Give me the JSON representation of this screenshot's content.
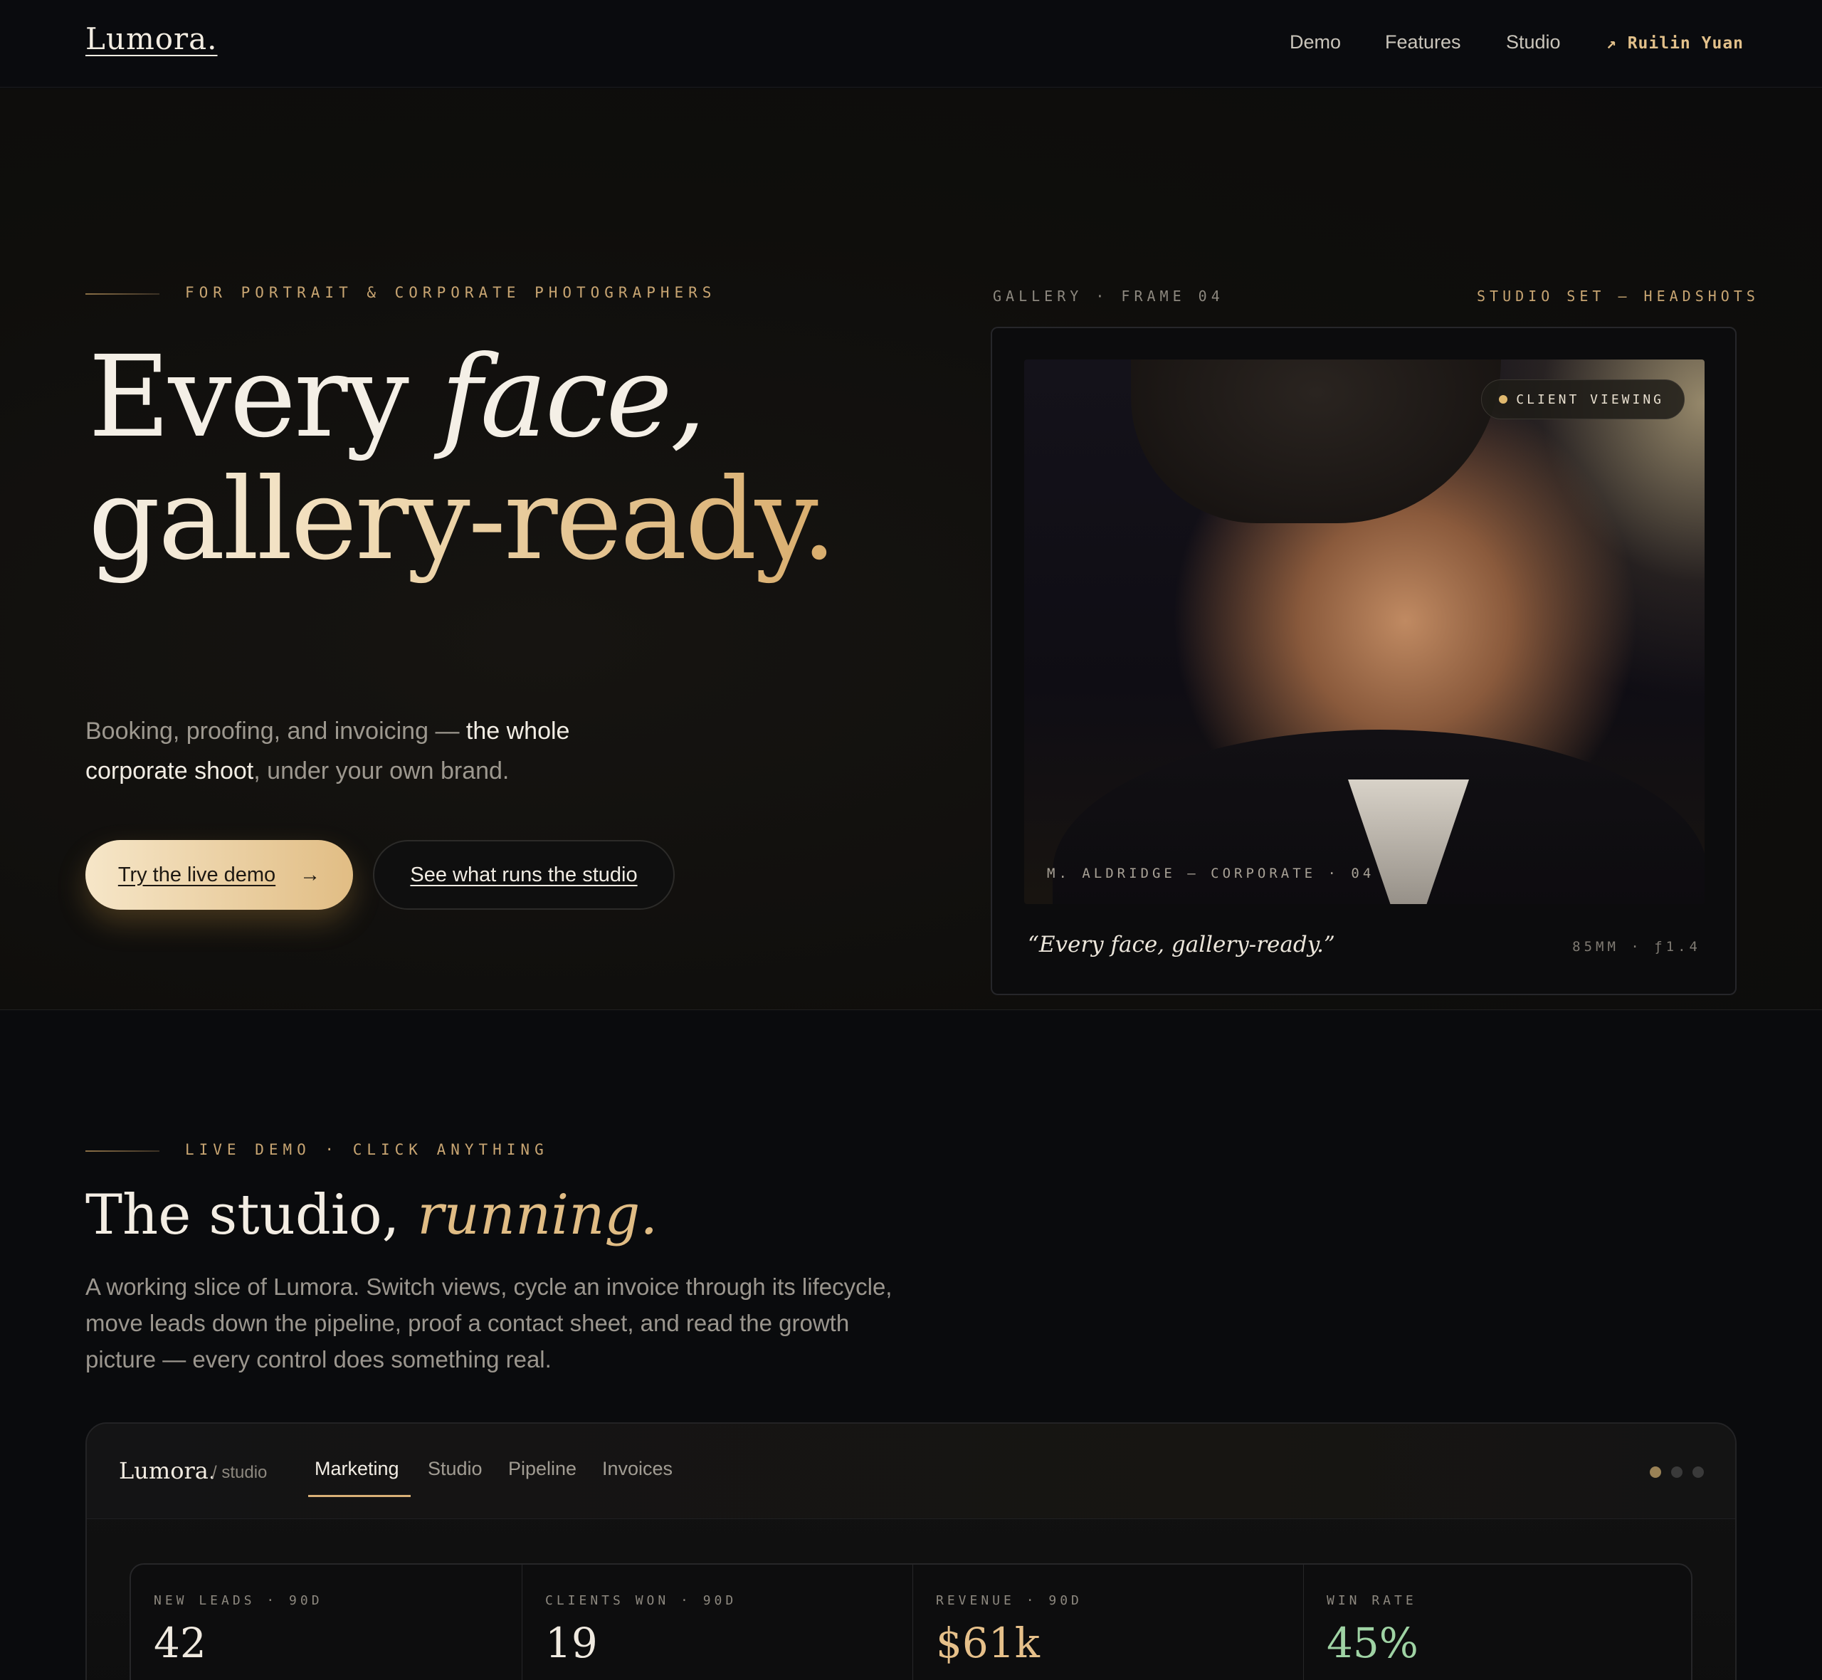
{
  "nav": {
    "logo": "Lumora.",
    "links": [
      "Demo",
      "Features",
      "Studio"
    ],
    "user": "↗ Ruilin Yuan"
  },
  "hero": {
    "kicker": "FOR PORTRAIT & CORPORATE PHOTOGRAPHERS",
    "headline_1": "Every ",
    "headline_1_italic": "face,",
    "headline_2": "gallery-ready.",
    "sub_1": "Booking, proofing, and invoicing — ",
    "sub_bold": "the whole corporate shoot",
    "sub_2": ", under your own brand.",
    "cta_primary": "Try the live demo",
    "cta_primary_icon": "→",
    "cta_secondary": "See what runs the studio"
  },
  "gallery": {
    "label_left": "GALLERY · FRAME 04",
    "label_right": "STUDIO SET — HEADSHOTS",
    "badge": "CLIENT VIEWING",
    "photo_caption": "M. ALDRIDGE — CORPORATE · 04",
    "quote": "“Every face, gallery-ready.”",
    "lens": "85MM · ƒ1.4"
  },
  "demo": {
    "kicker": "LIVE DEMO · CLICK ANYTHING",
    "title": "The studio, ",
    "title_italic": "running.",
    "description": "A working slice of Lumora. Switch views, cycle an invoice through its lifecycle, move leads down the pipeline, proof a contact sheet, and read the growth picture — every control does something real."
  },
  "app": {
    "logo": "Lumora.",
    "logo_sub": "/ studio",
    "tabs": [
      "Marketing",
      "Studio",
      "Pipeline",
      "Invoices"
    ],
    "active_tab": "Marketing",
    "stats": [
      {
        "label": "NEW LEADS · 90D",
        "value": "42",
        "color": "#f0eae0"
      },
      {
        "label": "CLIENTS WON · 90D",
        "value": "19",
        "color": "#f0eae0"
      },
      {
        "label": "REVENUE · 90D",
        "value": "$61k",
        "color": "#e6c08a"
      },
      {
        "label": "WIN RATE",
        "value": "45%",
        "color": "#9fd3a4"
      }
    ]
  },
  "colors": {
    "accent": "#d9b077",
    "background": "#0a0b0d"
  }
}
